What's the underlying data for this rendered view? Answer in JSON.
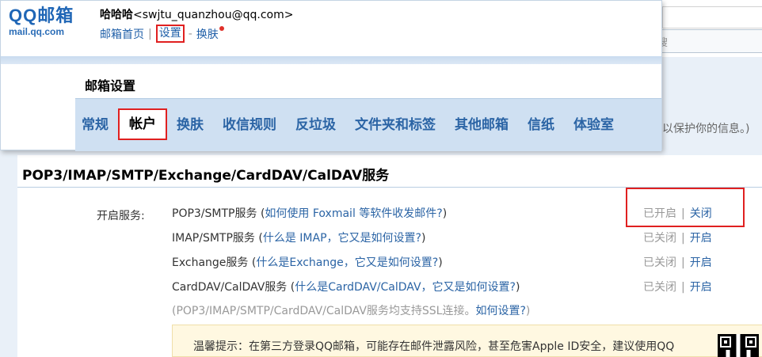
{
  "header": {
    "logo_main": "QQ邮箱",
    "logo_sub": "mail.qq.com",
    "user_name": "哈哈哈",
    "user_email": "<swjtu_quanzhou@qq.com>",
    "nav": {
      "home": "邮箱首页",
      "settings": "设置",
      "sep1": "|",
      "sep2": "-",
      "skin": "换肤"
    },
    "search_placeholder": "邮件搜"
  },
  "background": {
    "side_text": "以保护你的信息。)"
  },
  "settings": {
    "title": "邮箱设置",
    "tabs": [
      "常规",
      "帐户",
      "换肤",
      "收信规则",
      "反垃圾",
      "文件夹和标签",
      "其他邮箱",
      "信纸",
      "体验室"
    ],
    "active_tab": "帐户"
  },
  "section": {
    "title": "POP3/IMAP/SMTP/Exchange/CardDAV/CalDAV服务",
    "label": "开启服务:",
    "services": [
      {
        "name": "POP3/SMTP服务",
        "open_paren": " (",
        "help": "如何使用 Foxmail 等软件收发邮件?",
        "close_paren": ")",
        "state": "已开启",
        "pipe": "|",
        "action": "关闭"
      },
      {
        "name": "IMAP/SMTP服务",
        "open_paren": " (",
        "help": "什么是 IMAP，它又是如何设置?",
        "close_paren": ")",
        "state": "已关闭",
        "pipe": "|",
        "action": "开启"
      },
      {
        "name": "Exchange服务",
        "open_paren": " (",
        "help": "什么是Exchange，它又是如何设置?",
        "close_paren": ")",
        "state": "已关闭",
        "pipe": "|",
        "action": "开启"
      },
      {
        "name": "CardDAV/CalDAV服务",
        "open_paren": " (",
        "help": "什么是CardDAV/CalDAV，它又是如何设置?",
        "close_paren": ")",
        "state": "已关闭",
        "pipe": "|",
        "action": "开启"
      }
    ],
    "ssl_note_prefix": "(POP3/IMAP/SMTP/CardDAV/CalDAV服务均支持SSL连接。",
    "ssl_note_link": "如何设置?",
    "ssl_note_suffix": ")",
    "tip": "温馨提示：在第三方登录QQ邮箱，可能存在邮件泄露风险，甚至危害Apple ID安全，建议使用QQ"
  },
  "colors": {
    "link": "#2b64a5",
    "highlight_box": "#e02020",
    "tab_bar": "#cfe0f2",
    "tip_bg": "#fff8e1"
  }
}
